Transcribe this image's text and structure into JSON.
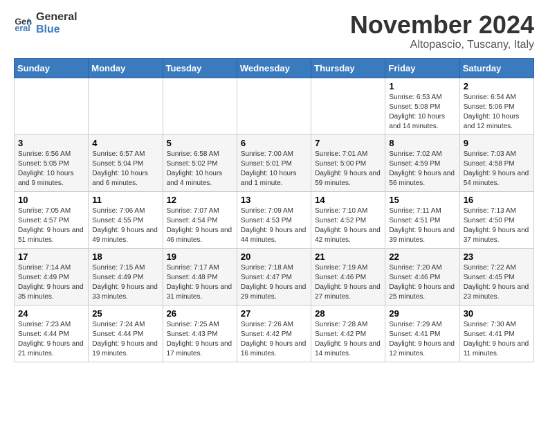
{
  "logo": {
    "line1": "General",
    "line2": "Blue"
  },
  "title": "November 2024",
  "location": "Altopascio, Tuscany, Italy",
  "days_of_week": [
    "Sunday",
    "Monday",
    "Tuesday",
    "Wednesday",
    "Thursday",
    "Friday",
    "Saturday"
  ],
  "weeks": [
    [
      {
        "day": "",
        "info": ""
      },
      {
        "day": "",
        "info": ""
      },
      {
        "day": "",
        "info": ""
      },
      {
        "day": "",
        "info": ""
      },
      {
        "day": "",
        "info": ""
      },
      {
        "day": "1",
        "info": "Sunrise: 6:53 AM\nSunset: 5:08 PM\nDaylight: 10 hours and 14 minutes."
      },
      {
        "day": "2",
        "info": "Sunrise: 6:54 AM\nSunset: 5:06 PM\nDaylight: 10 hours and 12 minutes."
      }
    ],
    [
      {
        "day": "3",
        "info": "Sunrise: 6:56 AM\nSunset: 5:05 PM\nDaylight: 10 hours and 9 minutes."
      },
      {
        "day": "4",
        "info": "Sunrise: 6:57 AM\nSunset: 5:04 PM\nDaylight: 10 hours and 6 minutes."
      },
      {
        "day": "5",
        "info": "Sunrise: 6:58 AM\nSunset: 5:02 PM\nDaylight: 10 hours and 4 minutes."
      },
      {
        "day": "6",
        "info": "Sunrise: 7:00 AM\nSunset: 5:01 PM\nDaylight: 10 hours and 1 minute."
      },
      {
        "day": "7",
        "info": "Sunrise: 7:01 AM\nSunset: 5:00 PM\nDaylight: 9 hours and 59 minutes."
      },
      {
        "day": "8",
        "info": "Sunrise: 7:02 AM\nSunset: 4:59 PM\nDaylight: 9 hours and 56 minutes."
      },
      {
        "day": "9",
        "info": "Sunrise: 7:03 AM\nSunset: 4:58 PM\nDaylight: 9 hours and 54 minutes."
      }
    ],
    [
      {
        "day": "10",
        "info": "Sunrise: 7:05 AM\nSunset: 4:57 PM\nDaylight: 9 hours and 51 minutes."
      },
      {
        "day": "11",
        "info": "Sunrise: 7:06 AM\nSunset: 4:55 PM\nDaylight: 9 hours and 49 minutes."
      },
      {
        "day": "12",
        "info": "Sunrise: 7:07 AM\nSunset: 4:54 PM\nDaylight: 9 hours and 46 minutes."
      },
      {
        "day": "13",
        "info": "Sunrise: 7:09 AM\nSunset: 4:53 PM\nDaylight: 9 hours and 44 minutes."
      },
      {
        "day": "14",
        "info": "Sunrise: 7:10 AM\nSunset: 4:52 PM\nDaylight: 9 hours and 42 minutes."
      },
      {
        "day": "15",
        "info": "Sunrise: 7:11 AM\nSunset: 4:51 PM\nDaylight: 9 hours and 39 minutes."
      },
      {
        "day": "16",
        "info": "Sunrise: 7:13 AM\nSunset: 4:50 PM\nDaylight: 9 hours and 37 minutes."
      }
    ],
    [
      {
        "day": "17",
        "info": "Sunrise: 7:14 AM\nSunset: 4:49 PM\nDaylight: 9 hours and 35 minutes."
      },
      {
        "day": "18",
        "info": "Sunrise: 7:15 AM\nSunset: 4:49 PM\nDaylight: 9 hours and 33 minutes."
      },
      {
        "day": "19",
        "info": "Sunrise: 7:17 AM\nSunset: 4:48 PM\nDaylight: 9 hours and 31 minutes."
      },
      {
        "day": "20",
        "info": "Sunrise: 7:18 AM\nSunset: 4:47 PM\nDaylight: 9 hours and 29 minutes."
      },
      {
        "day": "21",
        "info": "Sunrise: 7:19 AM\nSunset: 4:46 PM\nDaylight: 9 hours and 27 minutes."
      },
      {
        "day": "22",
        "info": "Sunrise: 7:20 AM\nSunset: 4:46 PM\nDaylight: 9 hours and 25 minutes."
      },
      {
        "day": "23",
        "info": "Sunrise: 7:22 AM\nSunset: 4:45 PM\nDaylight: 9 hours and 23 minutes."
      }
    ],
    [
      {
        "day": "24",
        "info": "Sunrise: 7:23 AM\nSunset: 4:44 PM\nDaylight: 9 hours and 21 minutes."
      },
      {
        "day": "25",
        "info": "Sunrise: 7:24 AM\nSunset: 4:44 PM\nDaylight: 9 hours and 19 minutes."
      },
      {
        "day": "26",
        "info": "Sunrise: 7:25 AM\nSunset: 4:43 PM\nDaylight: 9 hours and 17 minutes."
      },
      {
        "day": "27",
        "info": "Sunrise: 7:26 AM\nSunset: 4:42 PM\nDaylight: 9 hours and 16 minutes."
      },
      {
        "day": "28",
        "info": "Sunrise: 7:28 AM\nSunset: 4:42 PM\nDaylight: 9 hours and 14 minutes."
      },
      {
        "day": "29",
        "info": "Sunrise: 7:29 AM\nSunset: 4:41 PM\nDaylight: 9 hours and 12 minutes."
      },
      {
        "day": "30",
        "info": "Sunrise: 7:30 AM\nSunset: 4:41 PM\nDaylight: 9 hours and 11 minutes."
      }
    ]
  ]
}
